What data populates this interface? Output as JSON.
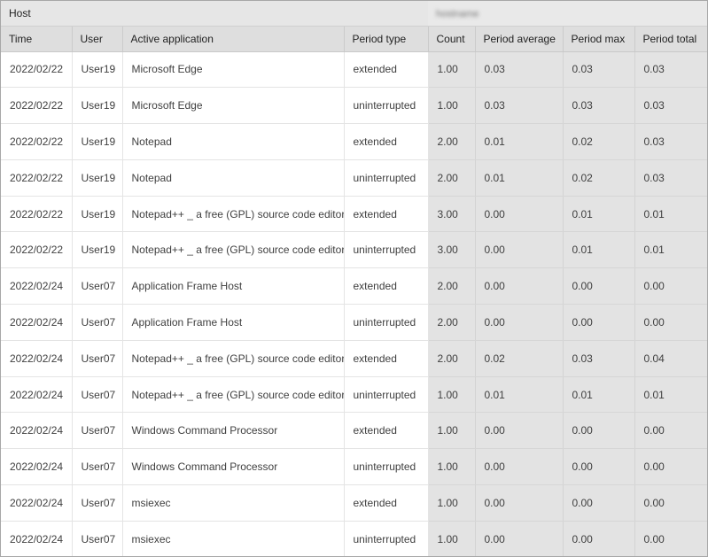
{
  "group_header": {
    "host_label": "Host",
    "host_value": "hostname"
  },
  "columns": {
    "time": "Time",
    "user": "User",
    "active_application": "Active application",
    "period_type": "Period type",
    "count": "Count",
    "period_average": "Period average",
    "period_max": "Period max",
    "period_total": "Period total"
  },
  "rows": [
    {
      "time": "2022/02/22",
      "user": "User19",
      "app": "Microsoft Edge",
      "ptype": "extended",
      "count": "1.00",
      "pavg": "0.03",
      "pmax": "0.03",
      "ptot": "0.03"
    },
    {
      "time": "2022/02/22",
      "user": "User19",
      "app": "Microsoft Edge",
      "ptype": "uninterrupted",
      "count": "1.00",
      "pavg": "0.03",
      "pmax": "0.03",
      "ptot": "0.03"
    },
    {
      "time": "2022/02/22",
      "user": "User19",
      "app": "Notepad",
      "ptype": "extended",
      "count": "2.00",
      "pavg": "0.01",
      "pmax": "0.02",
      "ptot": "0.03"
    },
    {
      "time": "2022/02/22",
      "user": "User19",
      "app": "Notepad",
      "ptype": "uninterrupted",
      "count": "2.00",
      "pavg": "0.01",
      "pmax": "0.02",
      "ptot": "0.03"
    },
    {
      "time": "2022/02/22",
      "user": "User19",
      "app": "Notepad++ _ a free (GPL) source code editor",
      "ptype": "extended",
      "count": "3.00",
      "pavg": "0.00",
      "pmax": "0.01",
      "ptot": "0.01"
    },
    {
      "time": "2022/02/22",
      "user": "User19",
      "app": "Notepad++ _ a free (GPL) source code editor",
      "ptype": "uninterrupted",
      "count": "3.00",
      "pavg": "0.00",
      "pmax": "0.01",
      "ptot": "0.01"
    },
    {
      "time": "2022/02/24",
      "user": "User07",
      "app": "Application Frame Host",
      "ptype": "extended",
      "count": "2.00",
      "pavg": "0.00",
      "pmax": "0.00",
      "ptot": "0.00"
    },
    {
      "time": "2022/02/24",
      "user": "User07",
      "app": "Application Frame Host",
      "ptype": "uninterrupted",
      "count": "2.00",
      "pavg": "0.00",
      "pmax": "0.00",
      "ptot": "0.00"
    },
    {
      "time": "2022/02/24",
      "user": "User07",
      "app": "Notepad++ _ a free (GPL) source code editor",
      "ptype": "extended",
      "count": "2.00",
      "pavg": "0.02",
      "pmax": "0.03",
      "ptot": "0.04"
    },
    {
      "time": "2022/02/24",
      "user": "User07",
      "app": "Notepad++ _ a free (GPL) source code editor",
      "ptype": "uninterrupted",
      "count": "1.00",
      "pavg": "0.01",
      "pmax": "0.01",
      "ptot": "0.01"
    },
    {
      "time": "2022/02/24",
      "user": "User07",
      "app": "Windows Command Processor",
      "ptype": "extended",
      "count": "1.00",
      "pavg": "0.00",
      "pmax": "0.00",
      "ptot": "0.00"
    },
    {
      "time": "2022/02/24",
      "user": "User07",
      "app": "Windows Command Processor",
      "ptype": "uninterrupted",
      "count": "1.00",
      "pavg": "0.00",
      "pmax": "0.00",
      "ptot": "0.00"
    },
    {
      "time": "2022/02/24",
      "user": "User07",
      "app": "msiexec",
      "ptype": "extended",
      "count": "1.00",
      "pavg": "0.00",
      "pmax": "0.00",
      "ptot": "0.00"
    },
    {
      "time": "2022/02/24",
      "user": "User07",
      "app": "msiexec",
      "ptype": "uninterrupted",
      "count": "1.00",
      "pavg": "0.00",
      "pmax": "0.00",
      "ptot": "0.00"
    }
  ],
  "colors": {
    "header_bg": "#dedede",
    "metric_bg": "#e3e3e3",
    "row_bg": "#ffffff",
    "border": "#a7a7a7"
  }
}
